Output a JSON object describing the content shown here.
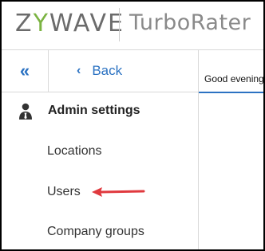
{
  "header": {
    "logo_pre": "Z",
    "logo_y": "Y",
    "logo_post": "WAVE",
    "product": "TurboRater"
  },
  "sidebar": {
    "collapse_glyph": "«",
    "back_glyph": "‹",
    "back_label": "Back",
    "section_title": "Admin settings",
    "items": [
      {
        "label": "Locations"
      },
      {
        "label": "Users"
      },
      {
        "label": "Company groups"
      }
    ]
  },
  "main": {
    "greeting": "Good evening"
  },
  "colors": {
    "accent": "#2b72c2",
    "logo_y": "#7bb342",
    "annotation_arrow": "#e0393e"
  }
}
